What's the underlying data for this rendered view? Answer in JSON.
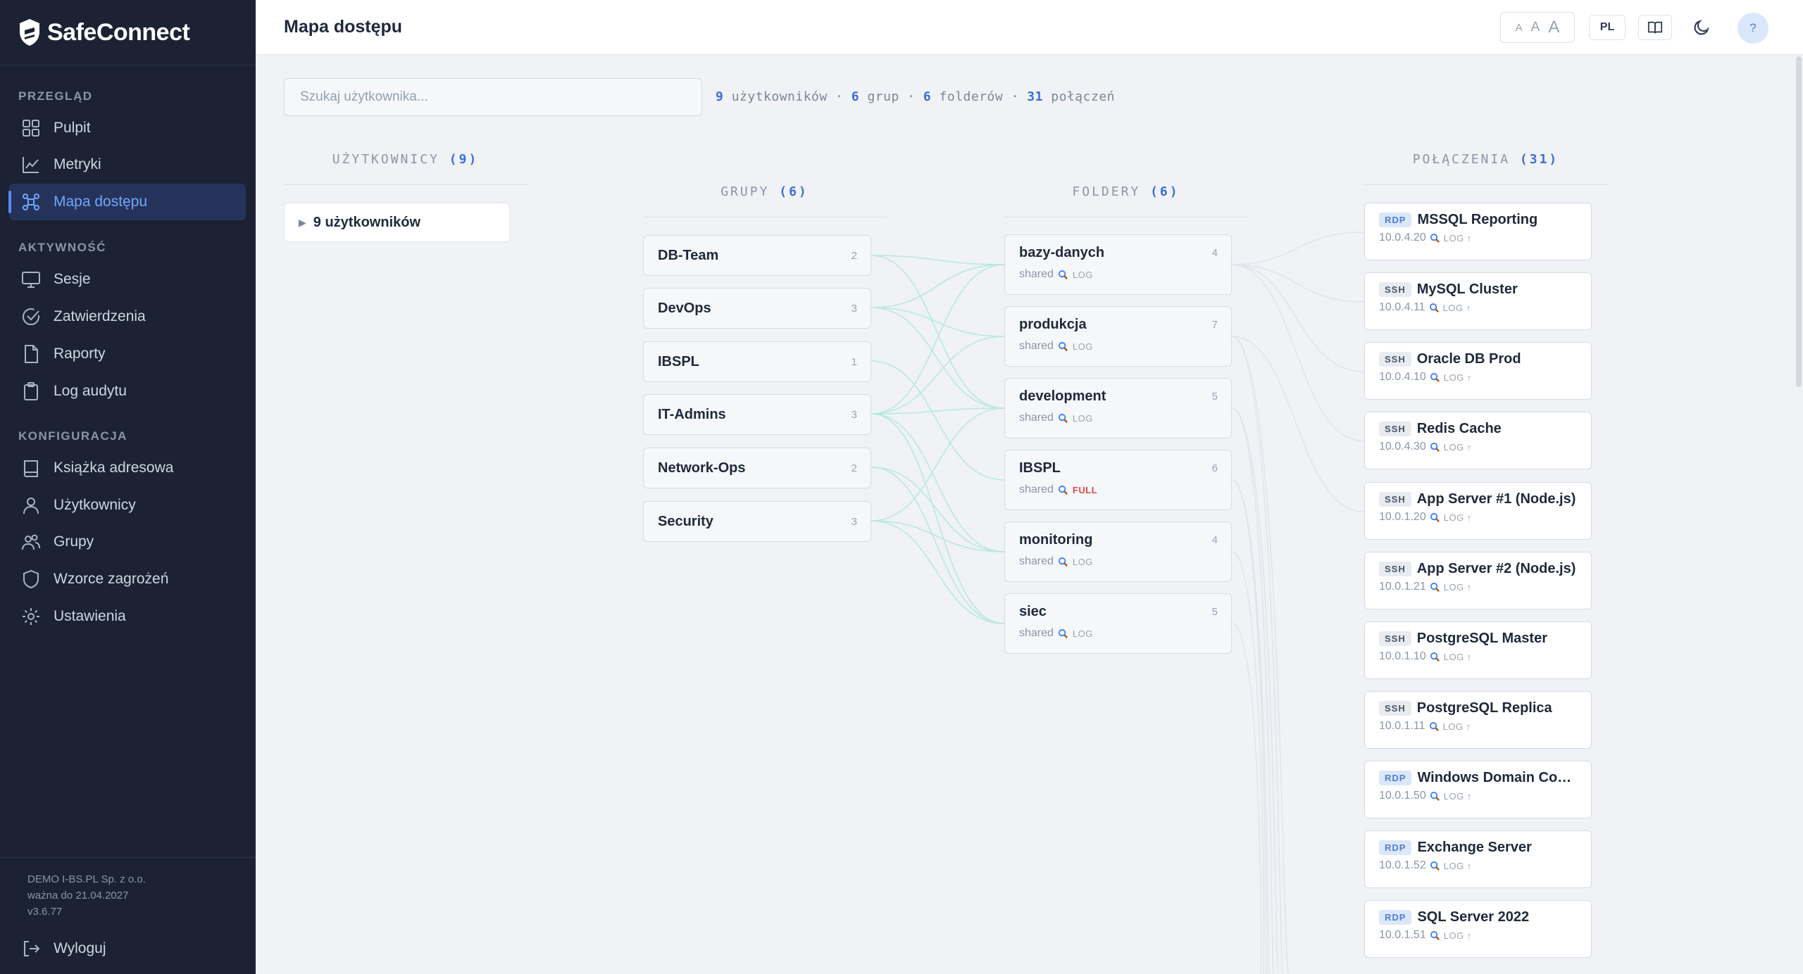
{
  "brand": {
    "name": "SafeConnect"
  },
  "sidebar": {
    "sections": [
      {
        "label": "PRZEGLĄD"
      },
      {
        "label": "AKTYWNOŚĆ"
      },
      {
        "label": "KONFIGURACJA"
      }
    ],
    "items": [
      {
        "label": "Pulpit",
        "icon": "grid-icon"
      },
      {
        "label": "Metryki",
        "icon": "chart-icon"
      },
      {
        "label": "Mapa dostępu",
        "icon": "access-map-icon",
        "active": true
      },
      {
        "label": "Sesje",
        "icon": "monitor-icon"
      },
      {
        "label": "Zatwierdzenia",
        "icon": "check-circle-icon"
      },
      {
        "label": "Raporty",
        "icon": "file-icon"
      },
      {
        "label": "Log audytu",
        "icon": "clipboard-icon"
      },
      {
        "label": "Książka adresowa",
        "icon": "book-icon"
      },
      {
        "label": "Użytkownicy",
        "icon": "user-icon"
      },
      {
        "label": "Grupy",
        "icon": "users-icon"
      },
      {
        "label": "Wzorce zagrożeń",
        "icon": "shield-icon"
      },
      {
        "label": "Ustawienia",
        "icon": "gear-icon"
      }
    ],
    "footer": {
      "company": "DEMO I-BS.PL Sp. z o.o.",
      "valid": "ważna do 21.04.2027",
      "version": "v3.6.77"
    },
    "logout_label": "Wyloguj"
  },
  "header": {
    "title": "Mapa dostępu",
    "font_sizes": [
      "A",
      "A",
      "A"
    ],
    "lang": "PL",
    "help": "?"
  },
  "search": {
    "placeholder": "Szukaj użytkownika..."
  },
  "stats": {
    "users_count": "9",
    "users_label": "użytkowników",
    "groups_count": "6",
    "groups_label": "grup",
    "folders_count": "6",
    "folders_label": "folderów",
    "connections_count": "31",
    "connections_label": "połączeń",
    "separator": "·"
  },
  "columns": {
    "users": {
      "label": "UŻYTKOWNICY",
      "count": "(9)"
    },
    "groups": {
      "label": "GRUPY",
      "count": "(6)"
    },
    "folders": {
      "label": "FOLDERY",
      "count": "(6)"
    },
    "connections": {
      "label": "POŁĄCZENIA",
      "count": "(31)"
    }
  },
  "users_toggle": {
    "label": "9 użytkowników"
  },
  "groups": [
    {
      "name": "DB-Team",
      "count": "2"
    },
    {
      "name": "DevOps",
      "count": "3"
    },
    {
      "name": "IBSPL",
      "count": "1"
    },
    {
      "name": "IT-Admins",
      "count": "3"
    },
    {
      "name": "Network-Ops",
      "count": "2"
    },
    {
      "name": "Security",
      "count": "3"
    }
  ],
  "folders": [
    {
      "name": "bazy-danych",
      "count": "4",
      "scope": "shared",
      "level": "LOG"
    },
    {
      "name": "produkcja",
      "count": "7",
      "scope": "shared",
      "level": "LOG"
    },
    {
      "name": "development",
      "count": "5",
      "scope": "shared",
      "level": "LOG"
    },
    {
      "name": "IBSPL",
      "count": "6",
      "scope": "shared",
      "level": "FULL"
    },
    {
      "name": "monitoring",
      "count": "4",
      "scope": "shared",
      "level": "LOG"
    },
    {
      "name": "siec",
      "count": "5",
      "scope": "shared",
      "level": "LOG"
    }
  ],
  "connections": [
    {
      "protocol": "RDP",
      "name": "MSSQL Reporting",
      "ip": "10.0.4.20",
      "level": "LOG ↑"
    },
    {
      "protocol": "SSH",
      "name": "MySQL Cluster",
      "ip": "10.0.4.11",
      "level": "LOG ↑"
    },
    {
      "protocol": "SSH",
      "name": "Oracle DB Prod",
      "ip": "10.0.4.10",
      "level": "LOG ↑"
    },
    {
      "protocol": "SSH",
      "name": "Redis Cache",
      "ip": "10.0.4.30",
      "level": "LOG ↑"
    },
    {
      "protocol": "SSH",
      "name": "App Server #1 (Node.js)",
      "ip": "10.0.1.20",
      "level": "LOG ↑"
    },
    {
      "protocol": "SSH",
      "name": "App Server #2 (Node.js)",
      "ip": "10.0.1.21",
      "level": "LOG ↑"
    },
    {
      "protocol": "SSH",
      "name": "PostgreSQL Master",
      "ip": "10.0.1.10",
      "level": "LOG ↑"
    },
    {
      "protocol": "SSH",
      "name": "PostgreSQL Replica",
      "ip": "10.0.1.11",
      "level": "LOG ↑"
    },
    {
      "protocol": "RDP",
      "name": "Windows Domain Controller",
      "ip": "10.0.1.50",
      "level": "LOG ↑"
    },
    {
      "protocol": "RDP",
      "name": "Exchange Server",
      "ip": "10.0.1.52",
      "level": "LOG ↑"
    },
    {
      "protocol": "RDP",
      "name": "SQL Server 2022",
      "ip": "10.0.1.51",
      "level": "LOG ↑"
    }
  ],
  "colors": {
    "accent": "#4f8cff",
    "sidebar_bg": "#1c2233",
    "link_teal": "#9ee6dc",
    "full_red": "#e04848"
  }
}
